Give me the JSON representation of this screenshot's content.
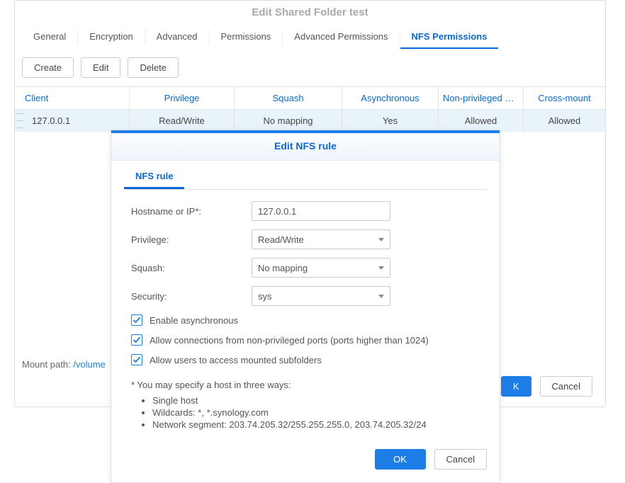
{
  "main": {
    "title": "Edit Shared Folder test",
    "tabs": {
      "general": "General",
      "encryption": "Encryption",
      "advanced": "Advanced",
      "permissions": "Permissions",
      "adv_permissions": "Advanced Permissions",
      "nfs_permissions": "NFS Permissions"
    },
    "toolbar": {
      "create": "Create",
      "edit": "Edit",
      "delete": "Delete"
    },
    "columns": {
      "client": "Client",
      "privilege": "Privilege",
      "squash": "Squash",
      "async": "Asynchronous",
      "nonpriv": "Non-privileged p…",
      "cross": "Cross-mount"
    },
    "row": {
      "client": "127.0.0.1",
      "privilege": "Read/Write",
      "squash": "No mapping",
      "async": "Yes",
      "nonpriv": "Allowed",
      "cross": "Allowed"
    },
    "mount_label": "Mount path: ",
    "mount_value": "/volume",
    "buttons": {
      "ok": "K",
      "cancel": "Cancel"
    }
  },
  "sub": {
    "title": "Edit NFS rule",
    "tab": "NFS rule",
    "labels": {
      "hostname": "Hostname or IP*:",
      "privilege": "Privilege:",
      "squash": "Squash:",
      "security": "Security:"
    },
    "values": {
      "hostname": "127.0.0.1",
      "privilege": "Read/Write",
      "squash": "No mapping",
      "security": "sys"
    },
    "checks": {
      "async": "Enable asynchronous",
      "nonpriv": "Allow connections from non-privileged ports (ports higher than 1024)",
      "subfolders": "Allow users to access mounted subfolders"
    },
    "note": {
      "intro": "* You may specify a host in three ways:",
      "li1": "Single host",
      "li2": "Wildcards: *, *.synology.com",
      "li3": "Network segment: 203.74.205.32/255.255.255.0, 203.74.205.32/24"
    },
    "buttons": {
      "ok": "OK",
      "cancel": "Cancel"
    }
  }
}
